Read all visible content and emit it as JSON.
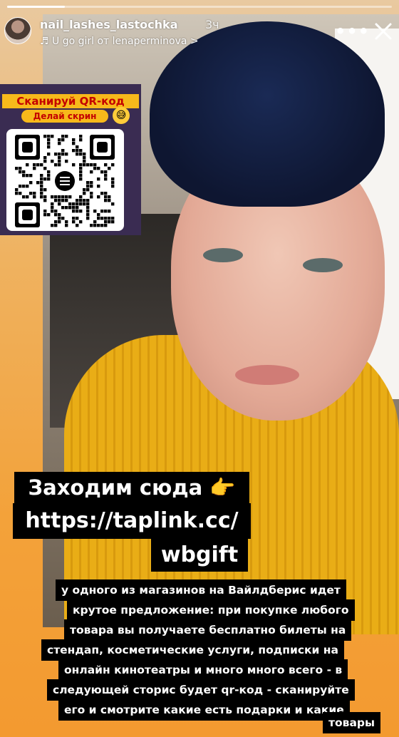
{
  "story": {
    "progress_fraction": 0.15,
    "header": {
      "username": "nail_lashes_lastochka",
      "time": "3ч",
      "music_text": "U go girl от lenaperminova",
      "music_chevron": ">",
      "more_glyph": "•••",
      "close_icon": "close-icon",
      "avatar_icon": "avatar"
    },
    "qr_sticker": {
      "title": "Сканируй QR-код",
      "subtitle": "Делай скрин",
      "emoji": "😅",
      "colors": {
        "bg": "#3a2c52",
        "banner": "#f7b91b",
        "text": "#c40000"
      }
    },
    "link_sticker": {
      "line1": "Заходим сюда 👉",
      "line2": "https://taplink.cc/",
      "line3": "wbgift"
    },
    "caption": {
      "lines": [
        "у одного из магазинов на Вайлдберис идет",
        "крутое предложение: при покупке любого",
        "товара вы получаете бесплатно билеты на",
        "стендап, косметические услуги, подписки на",
        "онлайн кинотеатры и много много всего -  в",
        "следующей сторис будет qr-код - сканируйте",
        "его и смотрите какие есть подарки и какие",
        "товары"
      ]
    }
  }
}
